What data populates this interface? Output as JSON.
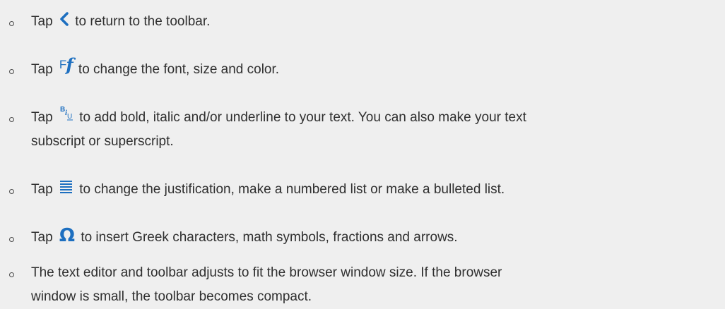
{
  "items": [
    {
      "prefix": "Tap",
      "icon": "chevron-left-icon",
      "text": "to return to the toolbar."
    },
    {
      "prefix": "Tap",
      "icon": "font-icon",
      "icon_glyph_cap": "F",
      "icon_glyph_italic": "f",
      "text": "to change the font, size and color."
    },
    {
      "prefix": "Tap",
      "icon": "text-style-icon",
      "text_line1": "to add bold, italic and/or underline to your text. You can also make your text",
      "text_line2": "subscript or superscript."
    },
    {
      "prefix": "Tap",
      "icon": "justify-icon",
      "text": "to change the justification, make a numbered list or make a bulleted list."
    },
    {
      "prefix": "Tap",
      "icon": "omega-icon",
      "icon_glyph": "Ω",
      "text": "to insert Greek characters, math symbols, fractions and arrows."
    },
    {
      "text_line1": "The text editor and toolbar adjusts to fit the browser window size. If the browser",
      "text_line2": "window is small, the toolbar becomes compact."
    }
  ],
  "colors": {
    "background": "#efefef",
    "text": "#2f2f2f",
    "icon": "#1d6fc0"
  }
}
